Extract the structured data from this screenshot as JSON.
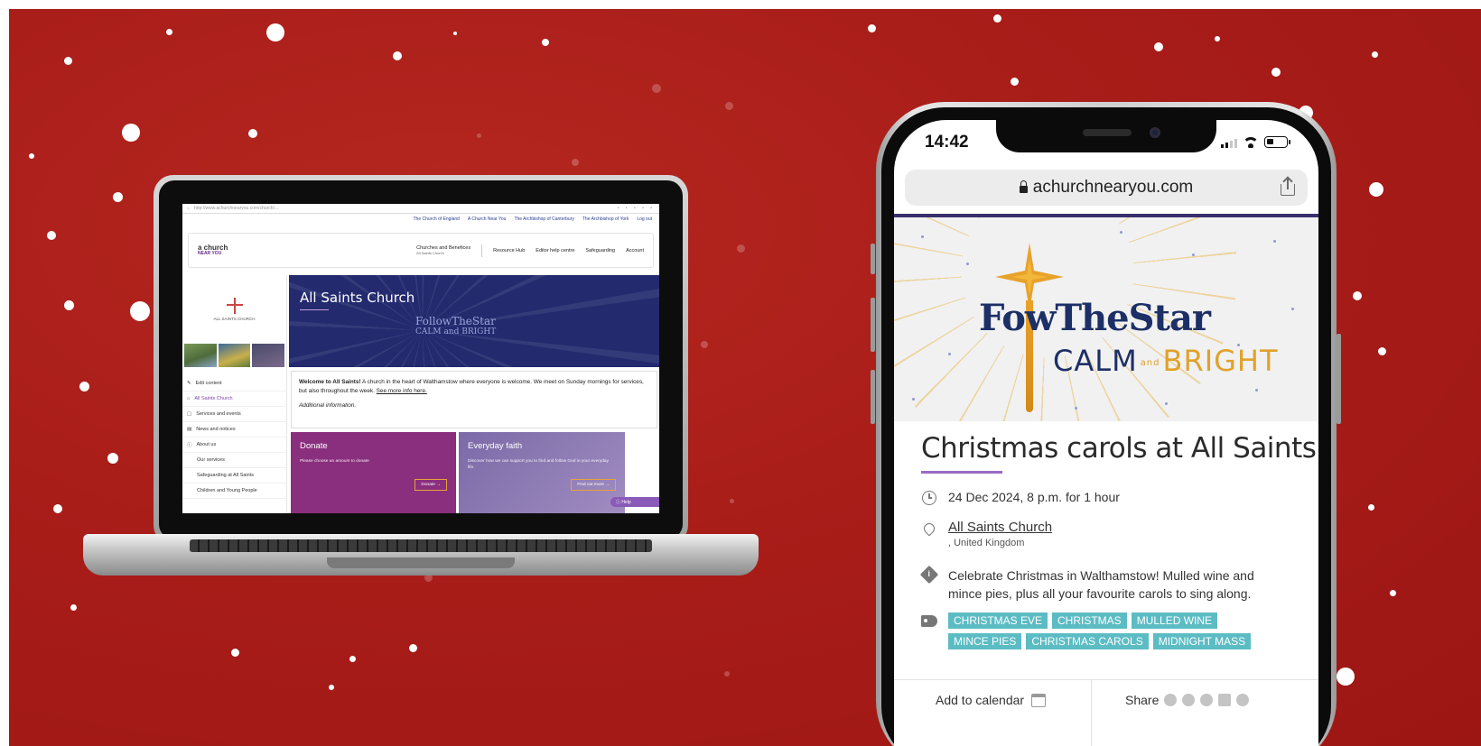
{
  "laptop": {
    "url": "http://www.achurchnearyou.com/church/...",
    "toplinks": [
      "The Church of England",
      "A Church Near You",
      "The Archbishop of Canterbury",
      "The Archbishop of York",
      "Log out"
    ],
    "logo": "a church",
    "logo_sub": "NEAR YOU",
    "nav": {
      "churches": "Churches and Benefices",
      "churches_sub": "All Saints Church",
      "resource_hub": "Resource Hub",
      "editor_help": "Editor help centre",
      "safeguarding": "Safeguarding",
      "account": "Account"
    },
    "church_logo_text": "ALL SAINTS CHURCH",
    "sidebar": [
      {
        "label": "Edit content"
      },
      {
        "label": "All Saints Church"
      },
      {
        "label": "Services and events"
      },
      {
        "label": "News and notices"
      },
      {
        "label": "About us"
      },
      {
        "label": "Our services"
      },
      {
        "label": "Safeguarding at All Saints"
      },
      {
        "label": "Children and Young People"
      }
    ],
    "hero_title": "All Saints Church",
    "hero_logo": "FollowTheStar",
    "hero_logo_sub": "CALM and BRIGHT",
    "welcome_bold": "Welcome to All Saints!",
    "welcome_text": " A church in the heart of Walthamstow where everyone is welcome. We meet on Sunday mornings for services, but also throughout the week.",
    "welcome_link": "See more info here.",
    "additional": "Additional information.",
    "donate_title": "Donate",
    "donate_text": "Please choose an amount to donate",
    "donate_button": "Donate →",
    "faith_title": "Everyday faith",
    "faith_text": "Discover how we can support you to find and follow God in your everyday life.",
    "faith_button": "Find out more →",
    "help": "Help"
  },
  "phone": {
    "time": "14:42",
    "address": "achurchnearyou.com",
    "banner_logo": "FowTheStar",
    "banner_calm": "CALM",
    "banner_and": "and",
    "banner_bright": "BRIGHT",
    "event_title": "Christmas carols at All Saints",
    "datetime": "24 Dec 2024, 8 p.m. for 1 hour",
    "location_name": "All Saints Church",
    "location_country": ", United Kingdom",
    "description": "Celebrate Christmas in Walthamstow! Mulled wine and mince pies, plus all your favourite carols to sing along.",
    "tags": [
      "CHRISTMAS EVE",
      "CHRISTMAS",
      "MULLED WINE",
      "MINCE PIES",
      "CHRISTMAS CAROLS",
      "MIDNIGHT MASS"
    ],
    "add_to_calendar": "Add to calendar",
    "share": "Share"
  },
  "colors": {
    "background": "#a91d19",
    "hero": "#232a6e",
    "accent_purple": "#9b6ac6",
    "tag_teal": "#5cbcc4",
    "star_gold": "#e0a22a",
    "logo_navy": "#1c2f66"
  }
}
